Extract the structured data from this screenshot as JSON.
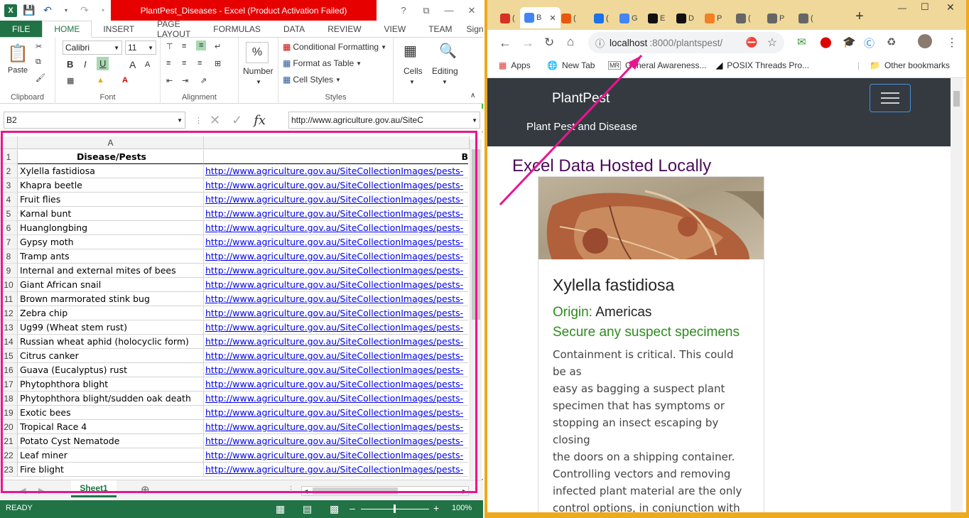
{
  "excel": {
    "window_title": "PlantPest_Diseases - Excel (Product Activation Failed)",
    "window_buttons": [
      "?",
      "⧉",
      "—",
      "✕"
    ],
    "ribbon_tabs": [
      "FILE",
      "HOME",
      "INSERT",
      "PAGE LAYOUT",
      "FORMULAS",
      "DATA",
      "REVIEW",
      "VIEW",
      "TEAM",
      "Sign"
    ],
    "clipboard": {
      "paste": "Paste",
      "label": "Clipboard"
    },
    "font": {
      "name": "Calibri",
      "size": "11",
      "label": "Font",
      "bold": "B",
      "italic": "I",
      "underline": "U",
      "grow": "A",
      "shrink": "A"
    },
    "alignment": {
      "label": "Alignment"
    },
    "number": {
      "label": "Number",
      "icon_text": "%"
    },
    "styles": {
      "conditional": "Conditional Formatting",
      "format_table": "Format as Table",
      "cell_styles": "Cell Styles",
      "label": "Styles"
    },
    "cells": {
      "label": "Cells"
    },
    "editing": {
      "label": "Editing"
    },
    "name_box": "B2",
    "formula": "http://www.agriculture.gov.au/SiteC",
    "fx": "fx",
    "column_a": "A",
    "column_b": "B",
    "header_a": "Disease/Pests",
    "rows": [
      {
        "num": "1",
        "a": "",
        "b": ""
      },
      {
        "num": "2",
        "a": "Xylella fastidiosa",
        "b": "http://www.agriculture.gov.au/SiteCollectionImages/pests-"
      },
      {
        "num": "3",
        "a": "Khapra beetle",
        "b": "http://www.agriculture.gov.au/SiteCollectionImages/pests-"
      },
      {
        "num": "4",
        "a": "Fruit flies",
        "b": "http://www.agriculture.gov.au/SiteCollectionImages/pests-"
      },
      {
        "num": "5",
        "a": "Karnal bunt",
        "b": "http://www.agriculture.gov.au/SiteCollectionImages/pests-"
      },
      {
        "num": "6",
        "a": "Huanglongbing",
        "b": "http://www.agriculture.gov.au/SiteCollectionImages/pests-"
      },
      {
        "num": "7",
        "a": "Gypsy moth",
        "b": "http://www.agriculture.gov.au/SiteCollectionImages/pests-"
      },
      {
        "num": "8",
        "a": "Tramp ants",
        "b": "http://www.agriculture.gov.au/SiteCollectionImages/pests-"
      },
      {
        "num": "9",
        "a": "Internal and external mites of bees",
        "b": "http://www.agriculture.gov.au/SiteCollectionImages/pests-"
      },
      {
        "num": "10",
        "a": "Giant African snail",
        "b": "http://www.agriculture.gov.au/SiteCollectionImages/pests-"
      },
      {
        "num": "11",
        "a": "Brown marmorated stink bug",
        "b": "http://www.agriculture.gov.au/SiteCollectionImages/pests-"
      },
      {
        "num": "12",
        "a": "Zebra chip",
        "b": "http://www.agriculture.gov.au/SiteCollectionImages/pests-"
      },
      {
        "num": "13",
        "a": "Ug99 (Wheat stem rust)",
        "b": "http://www.agriculture.gov.au/SiteCollectionImages/pests-"
      },
      {
        "num": "14",
        "a": "Russian wheat aphid (holocyclic form)",
        "b": "http://www.agriculture.gov.au/SiteCollectionImages/pests-"
      },
      {
        "num": "15",
        "a": "Citrus canker",
        "b": "http://www.agriculture.gov.au/SiteCollectionImages/pests-"
      },
      {
        "num": "16",
        "a": "Guava (Eucalyptus) rust",
        "b": "http://www.agriculture.gov.au/SiteCollectionImages/pests-"
      },
      {
        "num": "17",
        "a": "Phytophthora blight",
        "b": "http://www.agriculture.gov.au/SiteCollectionImages/pests-"
      },
      {
        "num": "18",
        "a": "Phytophthora blight/sudden oak death",
        "b": "http://www.agriculture.gov.au/SiteCollectionImages/pests-"
      },
      {
        "num": "19",
        "a": "Exotic bees",
        "b": "http://www.agriculture.gov.au/SiteCollectionImages/pests-"
      },
      {
        "num": "20",
        "a": "Tropical Race 4",
        "b": "http://www.agriculture.gov.au/SiteCollectionImages/pests-"
      },
      {
        "num": "21",
        "a": "Potato Cyst Nematode",
        "b": "http://www.agriculture.gov.au/SiteCollectionImages/pests-"
      },
      {
        "num": "22",
        "a": "Leaf miner",
        "b": "http://www.agriculture.gov.au/SiteCollectionImages/pests-"
      },
      {
        "num": "23",
        "a": "Fire blight",
        "b": "http://www.agriculture.gov.au/SiteCollectionImages/pests-"
      }
    ],
    "sheet_tab": "Sheet1",
    "status": "READY",
    "zoom": "100%",
    "accent": "#217346"
  },
  "chrome": {
    "tabs": [
      {
        "label": "(",
        "icon": "gmail-icon",
        "color": "#d93025"
      },
      {
        "label": "B",
        "icon": "active-tab-icon",
        "color": "#4285f4",
        "active": true
      },
      {
        "label": "(",
        "icon": "git-icon",
        "color": "#e8590c"
      },
      {
        "label": "(",
        "icon": "download-icon",
        "color": "#1a73e8"
      },
      {
        "label": "G",
        "icon": "google-icon",
        "color": "#4285f4"
      },
      {
        "label": "E",
        "icon": "github-icon",
        "color": "#111111"
      },
      {
        "label": "D",
        "icon": "github-icon",
        "color": "#111111"
      },
      {
        "label": "P",
        "icon": "stackoverflow-icon",
        "color": "#f48024"
      },
      {
        "label": "(",
        "icon": "globe-icon",
        "color": "#666666"
      },
      {
        "label": "P",
        "icon": "globe-icon",
        "color": "#666666"
      },
      {
        "label": "(",
        "icon": "globe-icon",
        "color": "#666666"
      }
    ],
    "new_tab": "+",
    "url_host": "localhost",
    "url_rest": ":8000/plantspest/",
    "bookmarks": [
      "Apps",
      "New Tab",
      "General Awareness...",
      "POSIX Threads Pro...",
      "Other bookmarks"
    ],
    "page": {
      "brand": "PlantPest",
      "subtitle": "Plant Pest and Disease",
      "heading": "Excel Data Hosted Locally",
      "card_title": "Xylella fastidiosa",
      "origin_label": "Origin:",
      "origin_value": "Americas",
      "secure_heading": "Secure any suspect specimens",
      "body_lines": [
        "Containment is critical. This could be as",
        "easy as bagging a suspect plant",
        "specimen that has symptoms or",
        "stopping an insect escaping by closing",
        "the doors on a shipping container.",
        "Controlling vectors and removing",
        "infected plant material are the only",
        "control options, in conjunction with"
      ],
      "heading_color": "#4b0c5a",
      "green": "#2e8b1e"
    }
  }
}
